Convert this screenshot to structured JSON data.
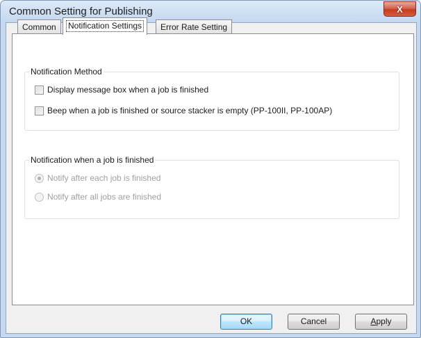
{
  "window": {
    "title": "Common Setting for Publishing",
    "close_icon": "close-icon",
    "close_glyph": "X"
  },
  "tabs": [
    {
      "label": "Common",
      "active": false
    },
    {
      "label": "Notification Settings",
      "active": true
    },
    {
      "label": "Error Rate Setting",
      "active": false
    }
  ],
  "notification_method": {
    "title": "Notification Method",
    "options": [
      {
        "label": "Display message box when a job is finished",
        "checked": false
      },
      {
        "label": "Beep when a job is finished or source stacker is empty (PP-100II, PP-100AP)",
        "checked": false
      }
    ]
  },
  "notification_when": {
    "title": "Notification when a job is finished",
    "options": [
      {
        "label": "Notify after each job is finished",
        "selected": true,
        "enabled": false
      },
      {
        "label": "Notify after all jobs are finished",
        "selected": false,
        "enabled": false
      }
    ]
  },
  "buttons": {
    "ok": "OK",
    "cancel": "Cancel",
    "apply_mnemonic": "A",
    "apply_rest": "pply"
  },
  "colors": {
    "close_button": "#c53b21",
    "default_button_border": "#3c7fb1",
    "title_bar": "#c4d8ef"
  }
}
